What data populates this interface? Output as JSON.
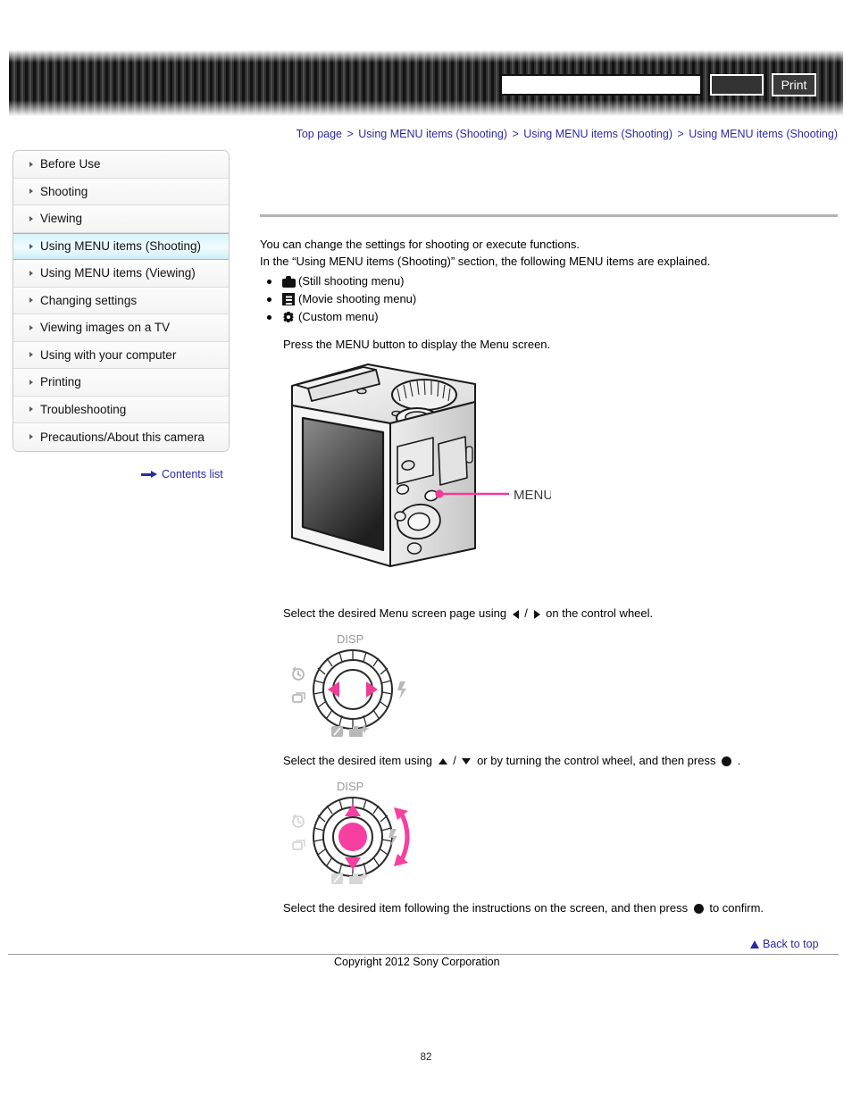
{
  "header": {
    "search_value": "",
    "search_placeholder": "",
    "search_button_label": "",
    "print_button_label": "Print"
  },
  "breadcrumb": {
    "items": [
      "Top page",
      "Using MENU items (Shooting)",
      "Using MENU items (Shooting)",
      "Using MENU items (Shooting)"
    ],
    "separator": ">"
  },
  "sidebar": {
    "items": [
      {
        "label": "Before Use",
        "active": false
      },
      {
        "label": "Shooting",
        "active": false
      },
      {
        "label": "Viewing",
        "active": false
      },
      {
        "label": "Using MENU items (Shooting)",
        "active": true
      },
      {
        "label": "Using MENU items (Viewing)",
        "active": false
      },
      {
        "label": "Changing settings",
        "active": false
      },
      {
        "label": "Viewing images on a TV",
        "active": false
      },
      {
        "label": "Using with your computer",
        "active": false
      },
      {
        "label": "Printing",
        "active": false
      },
      {
        "label": "Troubleshooting",
        "active": false
      },
      {
        "label": "Precautions/About this camera",
        "active": false
      }
    ],
    "contents_list_label": "Contents list"
  },
  "main": {
    "intro_line_1": "You can change the settings for shooting or execute functions.",
    "intro_line_2": "In the “Using MENU items (Shooting)” section, the following MENU items are explained.",
    "bullets": [
      {
        "icon": "still-camera-icon",
        "label": "(Still shooting menu)"
      },
      {
        "icon": "movie-film-icon",
        "label": "(Movie shooting menu)"
      },
      {
        "icon": "custom-gear-icon",
        "label": "(Custom menu)"
      }
    ],
    "step_1": "Press the MENU button to display the Menu screen.",
    "camera_callout_label": "MENU",
    "step_2_pre": "Select the desired Menu screen page using",
    "step_2_mid": "/",
    "step_2_post": "on the control wheel.",
    "step_3_pre": "Select the desired item using",
    "step_3_mid": "/",
    "step_3_post": "or by turning the control wheel, and then press",
    "step_3_end": ".",
    "step_4_pre": "Select the desired item following the instructions on the screen, and then press",
    "step_4_post": "to confirm.",
    "wheel_labels": {
      "top": "DISP",
      "left_upper": "self-timer-icon",
      "left_lower": "drive-mode-icon",
      "right": "flash-icon",
      "bottom_left": "exposure-comp-icon",
      "bottom_right": "photo-creativity-icon"
    }
  },
  "footer": {
    "back_to_top_label": "Back to top",
    "copyright": "Copyright 2012 Sony Corporation",
    "page_number": "82"
  },
  "colors": {
    "link": "#2a2aa5",
    "accent_pink": "#ef3d96",
    "active_cyan": "#6fc9e0"
  }
}
